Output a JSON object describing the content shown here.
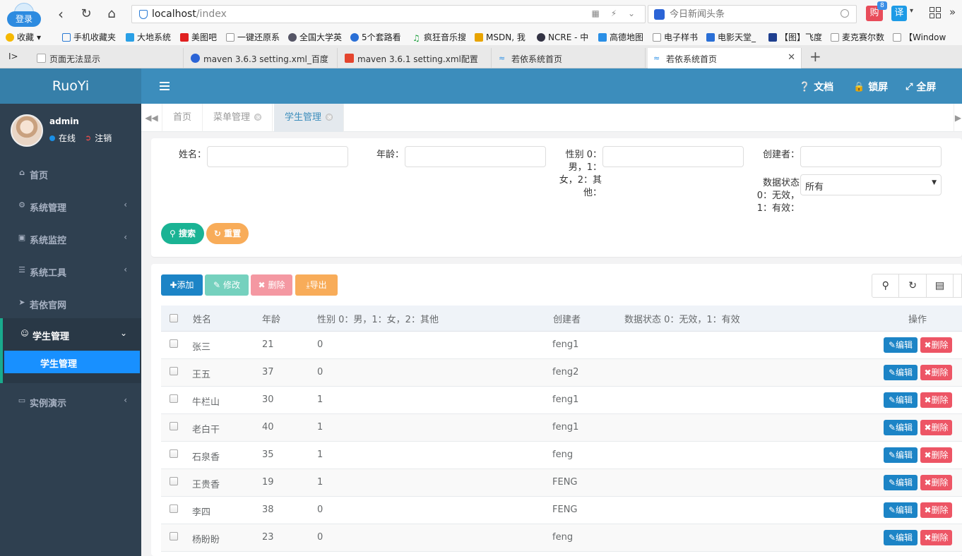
{
  "browser": {
    "login_label": "登录",
    "url_host": "localhost",
    "url_path": "/index",
    "search_placeholder": "今日新闻头条",
    "ext_shop": "购",
    "ext_shop_badge": "8",
    "ext_translate": "译",
    "bookmarks": [
      "收藏",
      "手机收藏夹",
      "大地系统",
      "美图吧",
      "一键还原系",
      "全国大学英",
      "5个套路看",
      "疯狂音乐搜",
      "MSDN, 我",
      "NCRE - 中",
      "高德地图",
      "电子样书",
      "电影天堂_",
      "【图】飞度",
      "麦克赛尔数",
      "【Window"
    ],
    "tabs": [
      "页面无法显示",
      "maven 3.6.3 setting.xml_百度",
      "maven 3.6.1 setting.xml配置",
      "若依系统首页",
      "若依系统首页"
    ]
  },
  "app": {
    "brand": "RuoYi",
    "header_links": {
      "docs": "文档",
      "lock": "锁屏",
      "fullscreen": "全屏"
    },
    "user": {
      "name": "admin",
      "online": "在线",
      "logout": "注销"
    },
    "menu": {
      "home": "首页",
      "system": "系统管理",
      "monitor": "系统监控",
      "tools": "系统工具",
      "website": "若依官网",
      "student": "学生管理",
      "student_sub": "学生管理",
      "demo": "实例演示"
    },
    "page_tabs": [
      "首页",
      "菜单管理",
      "学生管理"
    ]
  },
  "search": {
    "name_label": "姓名：",
    "age_label": "年龄：",
    "gender_label": [
      "性别 0：",
      "男，1：",
      "女，2：其",
      "他："
    ],
    "creator_label": "创建者：",
    "status_label": [
      "数据状态",
      "0：无效，",
      "1：有效："
    ],
    "status_value": "所有",
    "search_btn": "搜索",
    "reset_btn": "重置"
  },
  "toolbar": {
    "add": "添加",
    "edit": "修改",
    "delete": "删除",
    "export": "导出"
  },
  "table": {
    "columns": [
      "姓名",
      "年龄",
      "性别 0：男，1：女，2：其他",
      "创建者",
      "数据状态 0：无效，1：有效",
      "操作"
    ],
    "edit_label": "编辑",
    "delete_label": "删除",
    "rows": [
      {
        "name": "张三",
        "age": "21",
        "gender": "0",
        "creator": "feng1",
        "status": ""
      },
      {
        "name": "王五",
        "age": "37",
        "gender": "0",
        "creator": "feng2",
        "status": ""
      },
      {
        "name": "牛栏山",
        "age": "30",
        "gender": "1",
        "creator": "feng1",
        "status": ""
      },
      {
        "name": "老白干",
        "age": "40",
        "gender": "1",
        "creator": "feng1",
        "status": ""
      },
      {
        "name": "石泉香",
        "age": "35",
        "gender": "1",
        "creator": "feng",
        "status": ""
      },
      {
        "name": "王贵香",
        "age": "19",
        "gender": "1",
        "creator": "FENG",
        "status": ""
      },
      {
        "name": "李四",
        "age": "38",
        "gender": "0",
        "creator": "FENG",
        "status": ""
      },
      {
        "name": "杨盼盼",
        "age": "23",
        "gender": "0",
        "creator": "feng",
        "status": ""
      }
    ]
  },
  "colors": {
    "header": "#3c8dbc",
    "sidebar": "#2f4050",
    "primary": "#1c84c6",
    "success": "#1ab394",
    "warning": "#f8ac59",
    "danger": "#ed5565"
  }
}
